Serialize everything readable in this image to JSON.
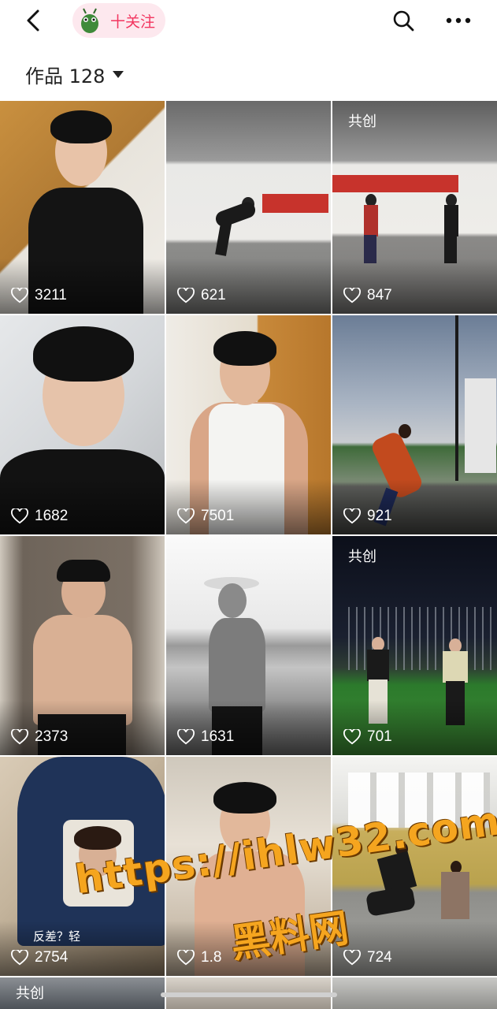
{
  "header": {
    "follow_label": "十关注"
  },
  "works": {
    "label": "作品 128"
  },
  "grid": {
    "tiles": [
      {
        "likes": "3211",
        "collab": "",
        "caption": ""
      },
      {
        "likes": "621",
        "collab": "",
        "caption": ""
      },
      {
        "likes": "847",
        "collab": "共创",
        "caption": ""
      },
      {
        "likes": "1682",
        "collab": "",
        "caption": ""
      },
      {
        "likes": "7501",
        "collab": "",
        "caption": ""
      },
      {
        "likes": "921",
        "collab": "",
        "caption": ""
      },
      {
        "likes": "2373",
        "collab": "",
        "caption": ""
      },
      {
        "likes": "1631",
        "collab": "",
        "caption": ""
      },
      {
        "likes": "701",
        "collab": "共创",
        "caption": ""
      },
      {
        "likes": "2754",
        "collab": "",
        "caption": "反差？轻"
      },
      {
        "likes": "1.8",
        "collab": "",
        "caption": ""
      },
      {
        "likes": "724",
        "collab": "",
        "caption": ""
      },
      {
        "likes": "",
        "collab": "共创",
        "caption": ""
      },
      {
        "likes": "",
        "collab": "",
        "caption": ""
      },
      {
        "likes": "",
        "collab": "",
        "caption": ""
      }
    ]
  },
  "watermark": {
    "url": "https://ihlw32.com",
    "name": "黑料网"
  },
  "colors": {
    "accent": "#f2355f",
    "pill_bg": "#fde8ee",
    "watermark": "#f5a51f"
  }
}
